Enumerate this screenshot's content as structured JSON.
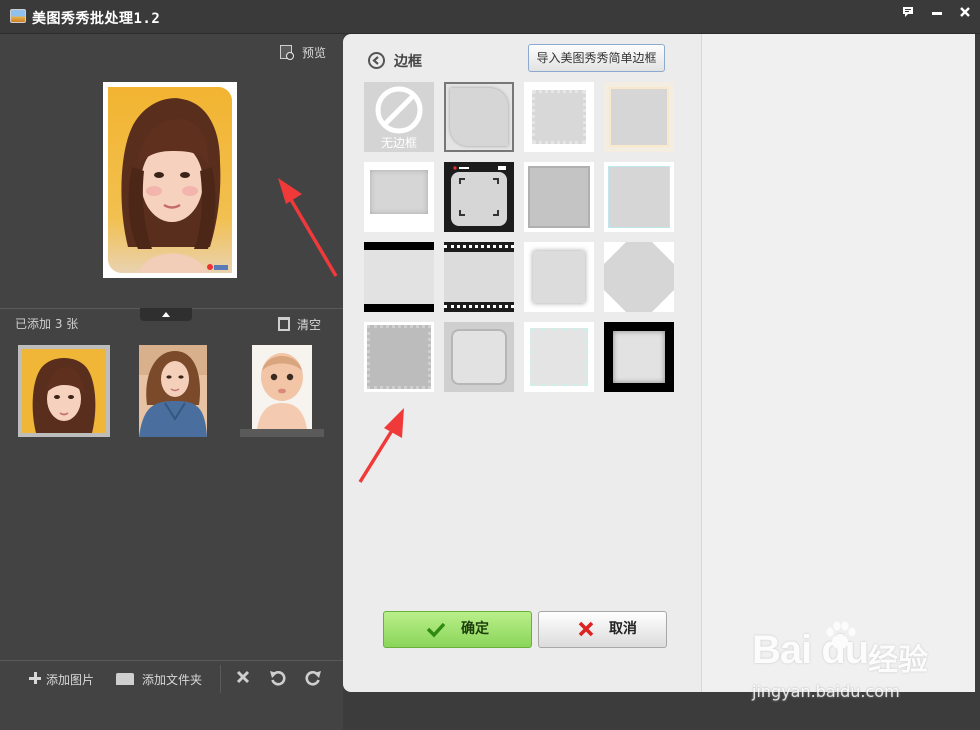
{
  "window": {
    "title": "美图秀秀批处理1.2",
    "controls": [
      "feedback-icon",
      "minimize-icon",
      "close-icon"
    ]
  },
  "left_panel": {
    "preview_label": "预览",
    "added_count_text": "已添加 3 张",
    "clear_label": "清空",
    "thumbnails": [
      {
        "name": "woman-brown-hair",
        "selected": true
      },
      {
        "name": "woman-denim-jacket",
        "selected": false
      },
      {
        "name": "baby-portrait",
        "selected": false
      }
    ],
    "toolbar": {
      "add_image_label": "添加图片",
      "add_folder_label": "添加文件夹",
      "icons": [
        "delete-icon",
        "rotate-left-icon",
        "rotate-right-icon"
      ]
    }
  },
  "border_panel": {
    "title": "边框",
    "import_button_label": "导入美图秀秀简单边框",
    "no_border_label": "无边框",
    "confirm_label": "确定",
    "cancel_label": "取消",
    "borders": [
      "no-border",
      "rounded-corner",
      "wavy-white",
      "cream-beige",
      "shadow-white",
      "camera-viewfinder",
      "grey-double",
      "cyan-corner",
      "black-bars",
      "film-strip",
      "white-shadow",
      "diagonal-corners",
      "grey-scalloped",
      "rounded-grey",
      "dotted-white",
      "thick-black"
    ]
  },
  "colors": {
    "dark_bg": "#434343",
    "titlebar_bg": "#3a3a3a",
    "panel_bg": "#ececec",
    "confirm_green": "#8bd55a",
    "arrow_red": "#f03a3a"
  },
  "watermark": {
    "logo_text": "Bai du",
    "cn_text": "经验",
    "url": "jingyan.baidu.com"
  }
}
